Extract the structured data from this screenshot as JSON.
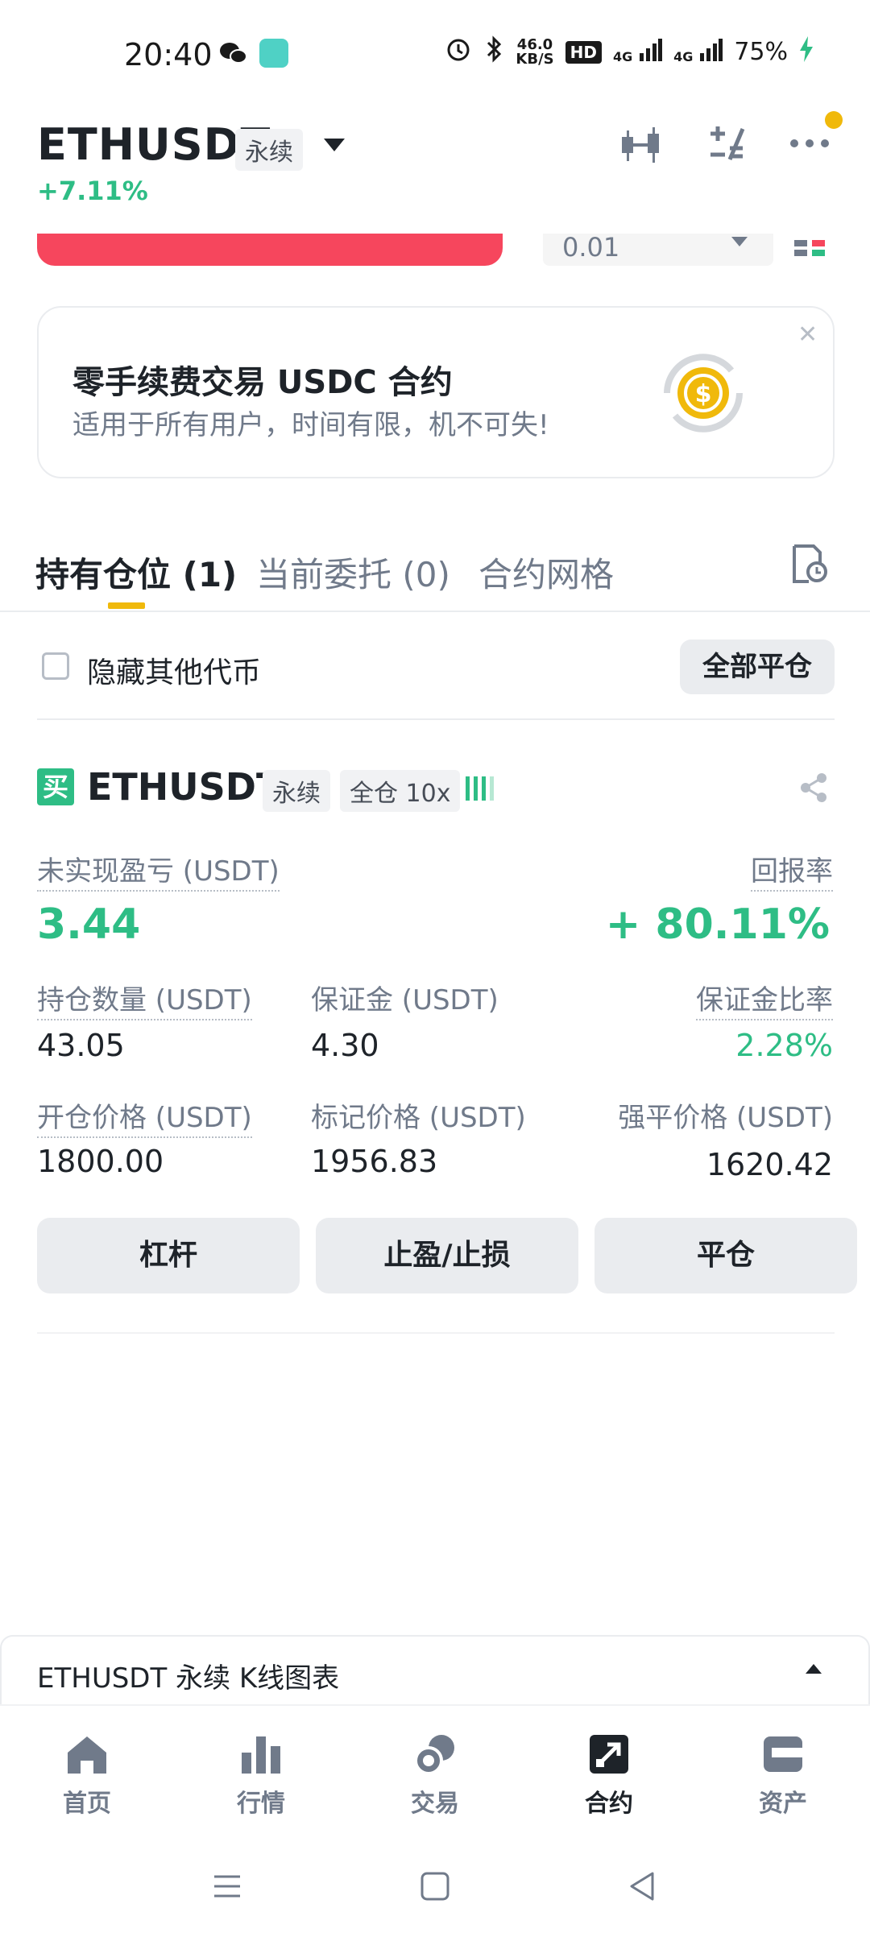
{
  "status_bar": {
    "time": "20:40",
    "speed_top": "46.0",
    "speed_unit": "KB/S",
    "hd": "HD",
    "net1": "4G",
    "net2": "4G",
    "battery": "75%"
  },
  "header": {
    "symbol": "ETHUSDT",
    "type_tag": "永续",
    "change": "+7.11%"
  },
  "order_strip": {
    "amount_value": "0.01"
  },
  "banner": {
    "title": "零手续费交易 USDC 合约",
    "subtitle": "适用于所有用户，时间有限，机不可失!"
  },
  "tabs": [
    {
      "label": "持有仓位 (1)"
    },
    {
      "label": "当前委托 (0)"
    },
    {
      "label": "合约网格"
    }
  ],
  "filters": {
    "hide_others_label": "隐藏其他代币",
    "close_all_label": "全部平仓"
  },
  "position": {
    "side_badge": "买",
    "symbol": "ETHUSDT",
    "type_tag": "永续",
    "margin_tag": "全仓 10x",
    "pnl_label": "未实现盈亏 (USDT)",
    "pnl_value": "3.44",
    "roe_label": "回报率",
    "roe_value": "+ 80.11%",
    "size_label": "持仓数量 (USDT)",
    "size_value": "43.05",
    "margin_label": "保证金 (USDT)",
    "margin_value": "4.30",
    "margin_ratio_label": "保证金比率",
    "margin_ratio_value": "2.28%",
    "entry_label": "开仓价格 (USDT)",
    "entry_value": "1800.00",
    "mark_label": "标记价格 (USDT)",
    "mark_value": "1956.83",
    "liq_label": "强平价格 (USDT)",
    "liq_value": "1620.42",
    "buttons": {
      "leverage": "杠杆",
      "tpsl": "止盈/止损",
      "close": "平仓"
    }
  },
  "kline_bar": {
    "label": "ETHUSDT 永续 K线图表"
  },
  "bottom_nav": [
    {
      "label": "首页",
      "icon": "home-icon"
    },
    {
      "label": "行情",
      "icon": "markets-icon"
    },
    {
      "label": "交易",
      "icon": "trade-icon"
    },
    {
      "label": "合约",
      "icon": "futures-icon",
      "active": true
    },
    {
      "label": "资产",
      "icon": "wallet-icon"
    }
  ],
  "colors": {
    "accent": "#f0b90b",
    "up": "#2ebd85",
    "down": "#f6465d",
    "text": "#1e2329",
    "muted": "#707a8a"
  }
}
